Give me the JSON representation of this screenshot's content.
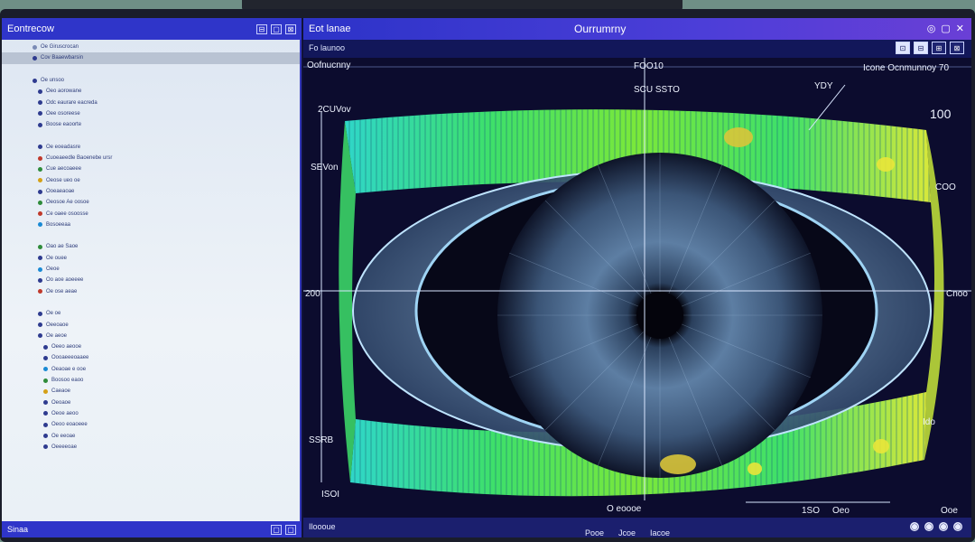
{
  "sidebar": {
    "title": "Eontrecow",
    "header_icons": [
      "⊟",
      "▢",
      "⊠"
    ],
    "tree": [
      {
        "label": "Oe Giruscrocan",
        "indent": 28,
        "color": "#7a8bb5",
        "selected": false
      },
      {
        "label": "Cov Baaewbarsin",
        "indent": 28,
        "color": "#2e3b8f",
        "selected": true
      },
      {
        "label": "",
        "indent": 0,
        "color": "",
        "selected": false
      },
      {
        "label": "Oe unsoo",
        "indent": 28,
        "color": "#2e3b8f",
        "selected": false
      },
      {
        "label": "Oeo aorowane",
        "indent": 34,
        "color": "#2e3b8f",
        "selected": false
      },
      {
        "label": "Odc eaurare eacreda",
        "indent": 34,
        "color": "#2e3b8f",
        "selected": false
      },
      {
        "label": "Oee osoreese",
        "indent": 34,
        "color": "#2e3b8f",
        "selected": false
      },
      {
        "label": "Boose eaoorte",
        "indent": 34,
        "color": "#2e3b8f",
        "selected": false
      },
      {
        "label": "",
        "indent": 0,
        "color": "",
        "selected": false
      },
      {
        "label": "Oe eoeadasre",
        "indent": 34,
        "color": "#2e3b8f",
        "selected": false
      },
      {
        "label": "Cuoeaeedle Baoenebe ursr",
        "indent": 34,
        "color": "#c0392b",
        "selected": false
      },
      {
        "label": "Cue aecoaeee",
        "indent": 34,
        "color": "#2e8b3a",
        "selected": false
      },
      {
        "label": "Oeose ueo oe",
        "indent": 34,
        "color": "#d4a017",
        "selected": false
      },
      {
        "label": "Ooeaeaoae",
        "indent": 34,
        "color": "#2e3b8f",
        "selected": false
      },
      {
        "label": "Oeosoe Ae oosoe",
        "indent": 34,
        "color": "#2e8b3a",
        "selected": false
      },
      {
        "label": "Ce oaee osoosse",
        "indent": 34,
        "color": "#c0392b",
        "selected": false
      },
      {
        "label": "Bosoeeaa",
        "indent": 34,
        "color": "#1a8ad4",
        "selected": false
      },
      {
        "label": "",
        "indent": 0,
        "color": "",
        "selected": false
      },
      {
        "label": "Oao ae Saoe",
        "indent": 34,
        "color": "#2e8b3a",
        "selected": false
      },
      {
        "label": "Oe ouee",
        "indent": 34,
        "color": "#2e3b8f",
        "selected": false
      },
      {
        "label": "Oeoe",
        "indent": 34,
        "color": "#1a8ad4",
        "selected": false
      },
      {
        "label": "Oo aoe aoeeee",
        "indent": 34,
        "color": "#2e3b8f",
        "selected": false
      },
      {
        "label": "Oe ose aeae",
        "indent": 34,
        "color": "#c0392b",
        "selected": false
      },
      {
        "label": "",
        "indent": 0,
        "color": "",
        "selected": false
      },
      {
        "label": "Oe oe",
        "indent": 34,
        "color": "#2e3b8f",
        "selected": false
      },
      {
        "label": "Oeeoaoe",
        "indent": 34,
        "color": "#2e3b8f",
        "selected": false
      },
      {
        "label": "Oe aeoe",
        "indent": 34,
        "color": "#2e3b8f",
        "selected": false
      },
      {
        "label": "Oeeo aeooe",
        "indent": 40,
        "color": "#2e3b8f",
        "selected": false
      },
      {
        "label": "Oooaeeeoaaee",
        "indent": 40,
        "color": "#2e3b8f",
        "selected": false
      },
      {
        "label": "Oeaoae e ooe",
        "indent": 40,
        "color": "#1a8ad4",
        "selected": false
      },
      {
        "label": "Boosoo eaoo",
        "indent": 40,
        "color": "#2e8b3a",
        "selected": false
      },
      {
        "label": "Caeaoe",
        "indent": 40,
        "color": "#d4a017",
        "selected": false
      },
      {
        "label": "Oeoaoe",
        "indent": 40,
        "color": "#2e3b8f",
        "selected": false
      },
      {
        "label": "Oeoe aeoo",
        "indent": 40,
        "color": "#2e3b8f",
        "selected": false
      },
      {
        "label": "Oeoo eoaoeee",
        "indent": 40,
        "color": "#2e3b8f",
        "selected": false
      },
      {
        "label": "Oe eeoae",
        "indent": 40,
        "color": "#2e3b8f",
        "selected": false
      },
      {
        "label": "Oeeeeoae",
        "indent": 40,
        "color": "#2e3b8f",
        "selected": false
      }
    ],
    "footer_label": "Sinaa",
    "footer_icons": [
      "▢",
      "▢"
    ]
  },
  "main": {
    "title_left": "Eot lanae",
    "title_center": "Ourrumrny",
    "title_icons": [
      "◎",
      "▢",
      "✕"
    ],
    "toolbar_tab": "Fo launoo",
    "toolbar_tools": [
      "⊡",
      "⊟",
      "⊞",
      "⊠"
    ],
    "view_title": "Oofnucnny",
    "labels": {
      "top_center": "FOO10",
      "sub_center": "SCU SSTO",
      "right_title": "Icone Ocnmunnoy 70",
      "top_right_mark": "YDY",
      "scale_top": "100",
      "left_top": "2CUVov",
      "left_mid": "SEVon",
      "left_center": "200",
      "right_upper": "COO",
      "right_center": "Cnoo",
      "right_lower": "Ido",
      "left_bottom": "SSRB",
      "bottom_left": "ISOI",
      "bottom_center": "O eoooe",
      "bottom_scale_a": "1SO",
      "bottom_scale_b": "Oeo",
      "bottom_right": "Ooe"
    },
    "status_left": "Iloooue",
    "status_mid": [
      "Pooe",
      "Jcoe",
      "Iacoe"
    ],
    "status_icons": [
      "◯",
      "◯",
      "◯",
      "◯"
    ]
  },
  "colors": {
    "accent": "#2f35c9",
    "viewport_bg": "#0c0c2e",
    "heat_green": "#36e06a",
    "heat_yellow": "#e9e63a",
    "iris_blue": "#4a6f96"
  }
}
